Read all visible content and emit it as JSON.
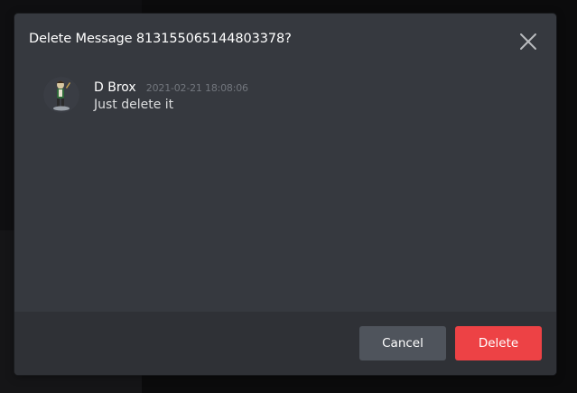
{
  "modal": {
    "title": "Delete Message 813155065144803378?",
    "close_icon": "close-icon"
  },
  "message": {
    "author": "D Brox",
    "timestamp": "2021-02-21 18:08:06",
    "content": "Just delete it",
    "avatar_icon": "avatar"
  },
  "footer": {
    "cancel_label": "Cancel",
    "delete_label": "Delete"
  },
  "colors": {
    "modal_bg": "#36393f",
    "footer_bg": "#2f3136",
    "cancel_bg": "#4f545c",
    "delete_bg": "#ed4245",
    "timestamp": "#72767d"
  }
}
